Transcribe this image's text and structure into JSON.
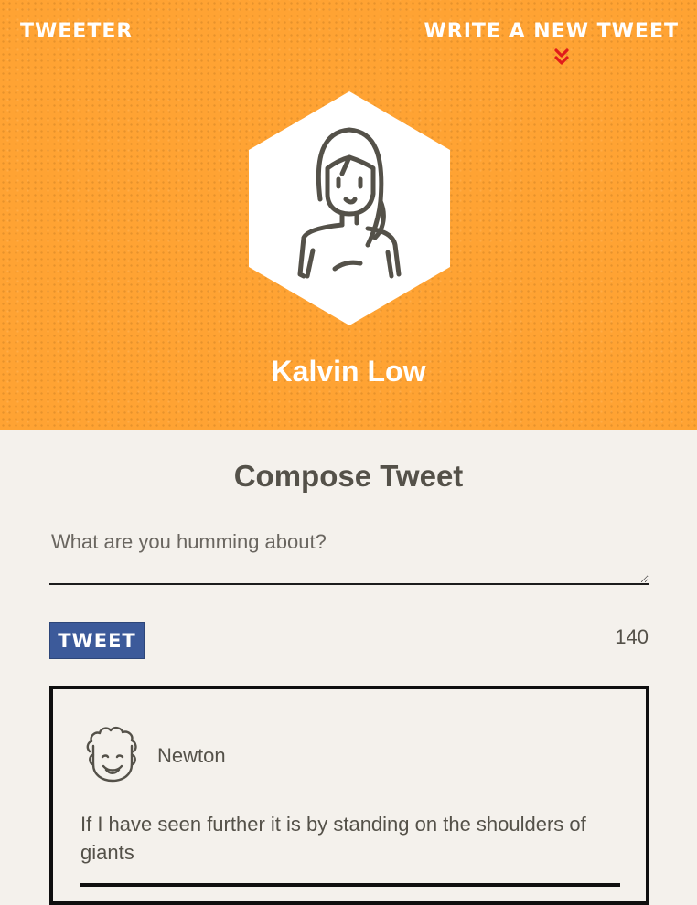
{
  "header": {
    "brand": "TWEETER",
    "write_link": "WRITE A NEW TWEET",
    "user_name": "Kalvin Low",
    "avatar_icon": "woman-avatar-icon"
  },
  "compose": {
    "title": "Compose Tweet",
    "placeholder": "What are you humming about?",
    "button_label": "TWEET",
    "char_count": "140"
  },
  "tweets": [
    {
      "author": "Newton",
      "avatar_icon": "curly-hair-man-avatar-icon",
      "text": "If I have seen further it is by standing on the shoulders of giants"
    }
  ],
  "colors": {
    "hero": "#ffa333",
    "background": "#f4f1ec",
    "button": "#3c5a9a",
    "chevron": "#e01b1b",
    "text": "#545149"
  }
}
